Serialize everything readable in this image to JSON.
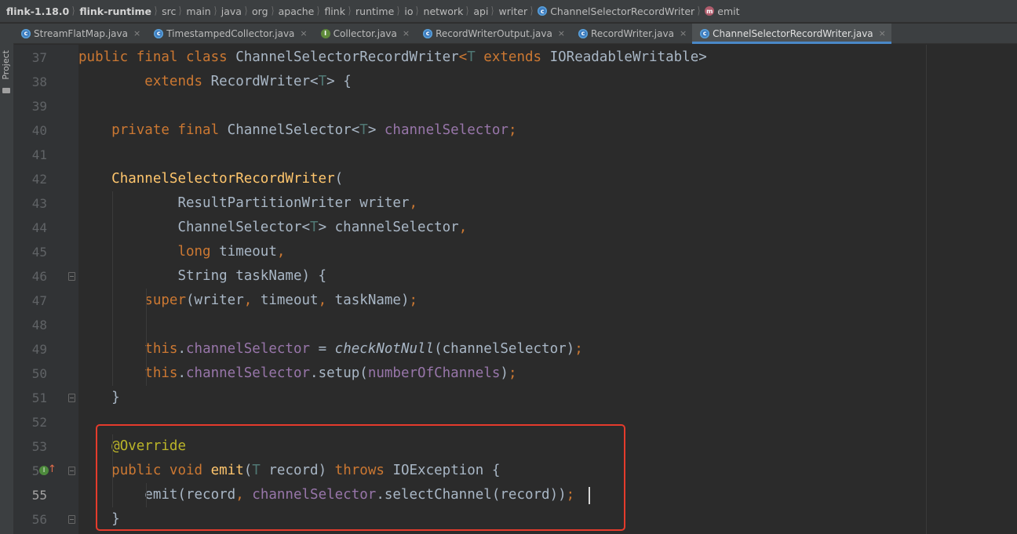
{
  "breadcrumb": [
    {
      "label": "flink-1.18.0",
      "bold": true
    },
    {
      "label": "flink-runtime",
      "bold": true
    },
    {
      "label": "src"
    },
    {
      "label": "main"
    },
    {
      "label": "java"
    },
    {
      "label": "org"
    },
    {
      "label": "apache"
    },
    {
      "label": "flink"
    },
    {
      "label": "runtime"
    },
    {
      "label": "io"
    },
    {
      "label": "network"
    },
    {
      "label": "api"
    },
    {
      "label": "writer"
    },
    {
      "label": "ChannelSelectorRecordWriter",
      "icon": "class-icon"
    },
    {
      "label": "emit",
      "icon": "method-icon"
    }
  ],
  "toolstrip": {
    "project_label": "Project"
  },
  "tabs": [
    {
      "label": "StreamFlatMap.java",
      "icon": "class-icon"
    },
    {
      "label": "TimestampedCollector.java",
      "icon": "class-icon"
    },
    {
      "label": "Collector.java",
      "icon": "interface-icon"
    },
    {
      "label": "RecordWriterOutput.java",
      "icon": "class-icon"
    },
    {
      "label": "RecordWriter.java",
      "icon": "abstract-class-icon"
    },
    {
      "label": "ChannelSelectorRecordWriter.java",
      "icon": "class-icon",
      "active": true
    }
  ],
  "tab_close_glyph": "×",
  "editor": {
    "current_line": 55,
    "lines": [
      {
        "n": "37",
        "tokens": [
          [
            "kw",
            "public final class "
          ],
          [
            "cls",
            "ChannelSelectorRecordWriter"
          ],
          [
            "punc",
            "<"
          ],
          [
            "tp",
            "T"
          ],
          [
            "kw",
            " extends "
          ],
          [
            "cls",
            "IOReadableWritable"
          ],
          [
            "cls",
            ">"
          ]
        ]
      },
      {
        "n": "38",
        "tokens": [
          [
            "",
            "        "
          ],
          [
            "kw",
            "extends "
          ],
          [
            "cls",
            "RecordWriter"
          ],
          [
            "cls",
            "<"
          ],
          [
            "tp",
            "T"
          ],
          [
            "cls",
            "> {"
          ]
        ]
      },
      {
        "n": "39",
        "tokens": []
      },
      {
        "n": "40",
        "tokens": [
          [
            "",
            "    "
          ],
          [
            "kw",
            "private final "
          ],
          [
            "cls",
            "ChannelSelector"
          ],
          [
            "cls",
            "<"
          ],
          [
            "tp",
            "T"
          ],
          [
            "cls",
            "> "
          ],
          [
            "fld",
            "channelSelector"
          ],
          [
            "punc",
            ";"
          ]
        ]
      },
      {
        "n": "41",
        "tokens": []
      },
      {
        "n": "42",
        "tokens": [
          [
            "",
            "    "
          ],
          [
            "mdecl",
            "ChannelSelectorRecordWriter"
          ],
          [
            "cls",
            "("
          ]
        ]
      },
      {
        "n": "43",
        "tokens": [
          [
            "",
            "            "
          ],
          [
            "cls",
            "ResultPartitionWriter writer"
          ],
          [
            "punc",
            ","
          ]
        ]
      },
      {
        "n": "44",
        "tokens": [
          [
            "",
            "            "
          ],
          [
            "cls",
            "ChannelSelector"
          ],
          [
            "cls",
            "<"
          ],
          [
            "tp",
            "T"
          ],
          [
            "cls",
            "> channelSelector"
          ],
          [
            "punc",
            ","
          ]
        ]
      },
      {
        "n": "45",
        "tokens": [
          [
            "",
            "            "
          ],
          [
            "kw",
            "long "
          ],
          [
            "cls",
            "timeout"
          ],
          [
            "punc",
            ","
          ]
        ]
      },
      {
        "n": "46",
        "tokens": [
          [
            "",
            "            "
          ],
          [
            "cls",
            "String taskName) {"
          ]
        ]
      },
      {
        "n": "47",
        "tokens": [
          [
            "",
            "        "
          ],
          [
            "kw",
            "super"
          ],
          [
            "cls",
            "(writer"
          ],
          [
            "punc",
            ", "
          ],
          [
            "cls",
            "timeout"
          ],
          [
            "punc",
            ", "
          ],
          [
            "cls",
            "taskName)"
          ],
          [
            "punc",
            ";"
          ]
        ]
      },
      {
        "n": "48",
        "tokens": []
      },
      {
        "n": "49",
        "tokens": [
          [
            "",
            "        "
          ],
          [
            "kw",
            "this"
          ],
          [
            "cls",
            "."
          ],
          [
            "fld",
            "channelSelector"
          ],
          [
            "cls",
            " = "
          ],
          [
            "it",
            "checkNotNull"
          ],
          [
            "cls",
            "(channelSelector)"
          ],
          [
            "punc",
            ";"
          ]
        ]
      },
      {
        "n": "50",
        "tokens": [
          [
            "",
            "        "
          ],
          [
            "kw",
            "this"
          ],
          [
            "cls",
            "."
          ],
          [
            "fld",
            "channelSelector"
          ],
          [
            "cls",
            ".setup("
          ],
          [
            "fld",
            "numberOfChannels"
          ],
          [
            "cls",
            ")"
          ],
          [
            "punc",
            ";"
          ]
        ]
      },
      {
        "n": "51",
        "tokens": [
          [
            "",
            "    "
          ],
          [
            "cls",
            "}"
          ]
        ]
      },
      {
        "n": "52",
        "tokens": []
      },
      {
        "n": "53",
        "tokens": [
          [
            "",
            "    "
          ],
          [
            "ann",
            "@Override"
          ]
        ]
      },
      {
        "n": "54",
        "tokens": [
          [
            "",
            "    "
          ],
          [
            "kw",
            "public void "
          ],
          [
            "mdecl",
            "emit"
          ],
          [
            "cls",
            "("
          ],
          [
            "tp",
            "T"
          ],
          [
            "cls",
            " record) "
          ],
          [
            "kw",
            "throws "
          ],
          [
            "cls",
            "IOException {"
          ]
        ]
      },
      {
        "n": "55",
        "tokens": [
          [
            "",
            "        "
          ],
          [
            "cls",
            "emit(record"
          ],
          [
            "punc",
            ", "
          ],
          [
            "fld",
            "channelSelector"
          ],
          [
            "cls",
            ".selectChannel(record))"
          ],
          [
            "punc",
            ";"
          ]
        ]
      },
      {
        "n": "56",
        "tokens": [
          [
            "",
            "    "
          ],
          [
            "cls",
            "}"
          ]
        ]
      }
    ]
  }
}
